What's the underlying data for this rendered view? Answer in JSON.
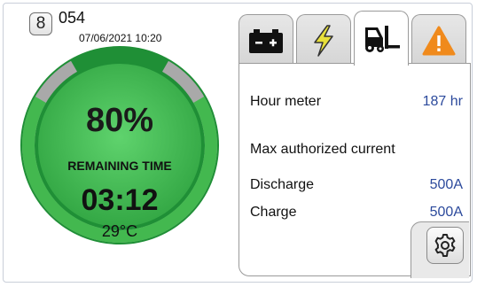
{
  "header": {
    "user_icon_glyph": "8",
    "device_id": "054",
    "datetime": "07/06/2021 10:20"
  },
  "gauge": {
    "charge_percent_label": "80%",
    "charge_fraction": 0.8,
    "remaining_label": "REMAINING TIME",
    "remaining_time": "03:12",
    "temperature": "29°C",
    "colors": {
      "fill": "#3bb04a",
      "dark": "#1e8a34",
      "empty": "#a7a7a7"
    }
  },
  "tabs": [
    {
      "icon": "battery-icon",
      "active": false
    },
    {
      "icon": "lightning-icon",
      "active": false
    },
    {
      "icon": "forklift-icon",
      "active": true
    },
    {
      "icon": "warning-icon",
      "active": false
    }
  ],
  "panel": {
    "hour_meter_label": "Hour meter",
    "hour_meter_value": "187 hr",
    "max_current_label": "Max authorized current",
    "discharge_label": "Discharge",
    "discharge_value": "500A",
    "charge_label": "Charge",
    "charge_value": "500A"
  },
  "settings": {
    "icon": "gear-icon"
  }
}
